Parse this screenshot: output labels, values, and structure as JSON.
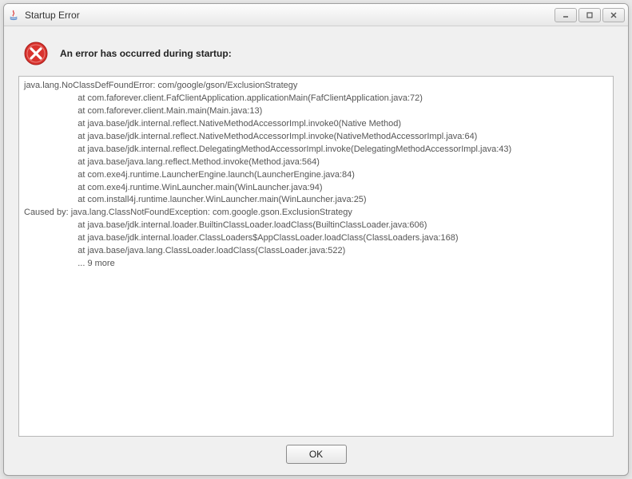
{
  "window": {
    "title": "Startup Error"
  },
  "header": {
    "message": "An error has occurred during startup:"
  },
  "stacktrace": {
    "lines": [
      "java.lang.NoClassDefFoundError: com/google/gson/ExclusionStrategy",
      "                      at com.faforever.client.FafClientApplication.applicationMain(FafClientApplication.java:72)",
      "                      at com.faforever.client.Main.main(Main.java:13)",
      "                      at java.base/jdk.internal.reflect.NativeMethodAccessorImpl.invoke0(Native Method)",
      "                      at java.base/jdk.internal.reflect.NativeMethodAccessorImpl.invoke(NativeMethodAccessorImpl.java:64)",
      "                      at java.base/jdk.internal.reflect.DelegatingMethodAccessorImpl.invoke(DelegatingMethodAccessorImpl.java:43)",
      "                      at java.base/java.lang.reflect.Method.invoke(Method.java:564)",
      "                      at com.exe4j.runtime.LauncherEngine.launch(LauncherEngine.java:84)",
      "                      at com.exe4j.runtime.WinLauncher.main(WinLauncher.java:94)",
      "                      at com.install4j.runtime.launcher.WinLauncher.main(WinLauncher.java:25)",
      "Caused by: java.lang.ClassNotFoundException: com.google.gson.ExclusionStrategy",
      "                      at java.base/jdk.internal.loader.BuiltinClassLoader.loadClass(BuiltinClassLoader.java:606)",
      "                      at java.base/jdk.internal.loader.ClassLoaders$AppClassLoader.loadClass(ClassLoaders.java:168)",
      "                      at java.base/java.lang.ClassLoader.loadClass(ClassLoader.java:522)",
      "                      ... 9 more"
    ]
  },
  "buttons": {
    "ok": "OK"
  }
}
